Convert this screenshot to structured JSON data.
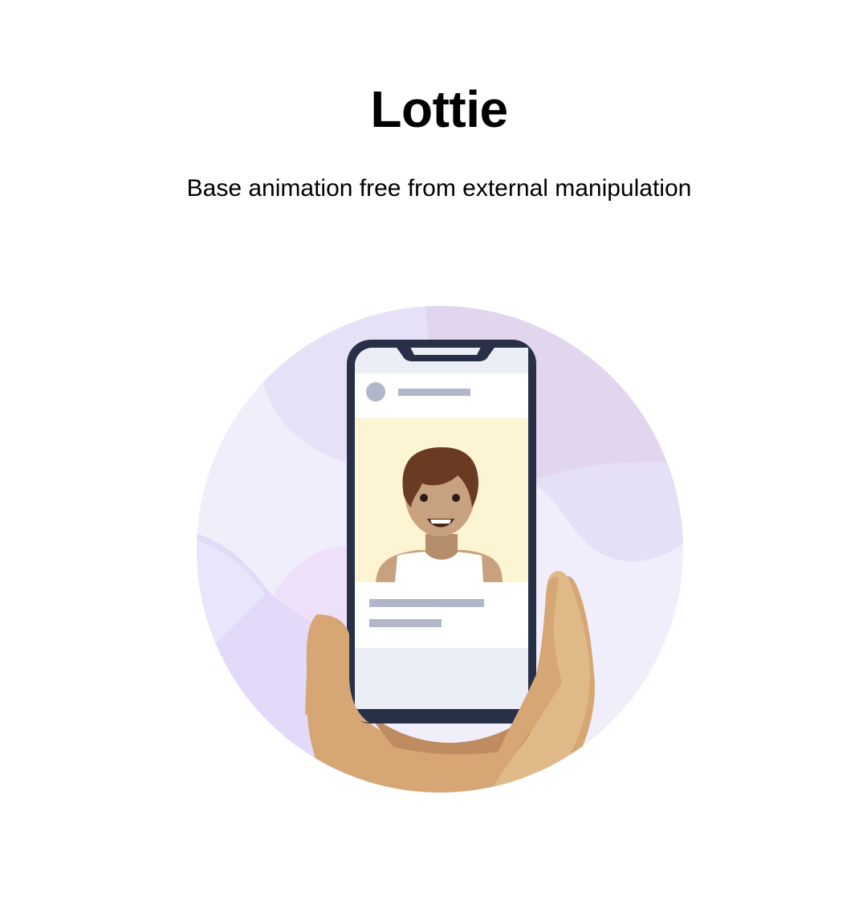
{
  "page": {
    "title": "Lottie",
    "subtitle": "Base animation free from external manipulation"
  },
  "illustration": {
    "description_icon": "phone-in-hand-animation",
    "colors": {
      "circle_base": "#F1EEFC",
      "blob_purple": "#E4DAF0",
      "blob_lavender": "#E6E1F6",
      "blob_lilac": "#E2DAF8",
      "phone_frame": "#283048",
      "screen_bg": "#FFFFFF",
      "screen_gray": "#EBEEF5",
      "placeholder_gray": "#B1B7C8",
      "photo_bg": "#FDF4D4",
      "skin": "#C8A17F",
      "hair": "#6B3A22",
      "hand_dark": "#D6A674",
      "hand_light": "#E0B988",
      "hand_shadow": "#BE8C60"
    }
  }
}
